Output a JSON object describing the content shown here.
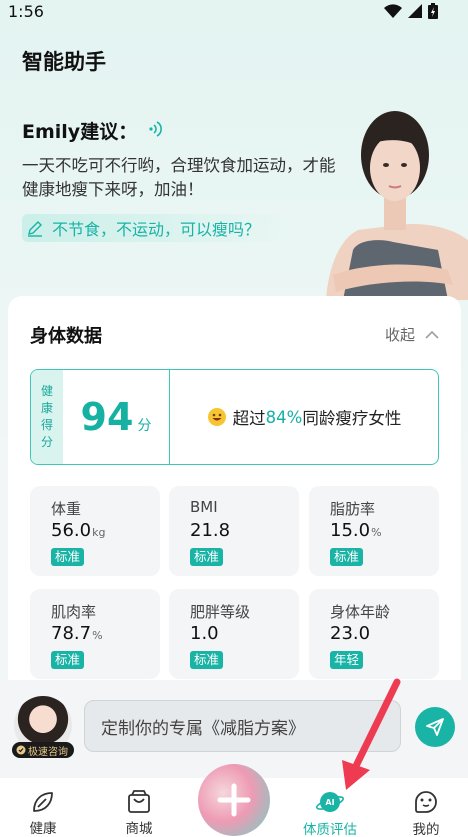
{
  "status": {
    "time": "1:56"
  },
  "header": {
    "title": "智能助手"
  },
  "advice": {
    "name": "Emily建议：",
    "text": "一天不吃可不行哟，合理饮食加运动，才能健康地瘦下来呀，加油！",
    "question": "不节食，不运动，可以瘦吗？"
  },
  "body_data": {
    "title": "身体数据",
    "collapse_label": "收起",
    "score": {
      "tag_chars": [
        "健",
        "康",
        "得",
        "分"
      ],
      "value": "94",
      "unit": "分",
      "compare_prefix": "超过",
      "compare_pct": "84%",
      "compare_suffix": "同龄瘦疗女性"
    },
    "metrics": [
      {
        "label": "体重",
        "value": "56.0",
        "unit": "kg",
        "badge": "标准"
      },
      {
        "label": "BMI",
        "value": "21.8",
        "unit": "",
        "badge": "标准"
      },
      {
        "label": "脂肪率",
        "value": "15.0",
        "unit": "%",
        "badge": "标准"
      },
      {
        "label": "肌肉率",
        "value": "78.7",
        "unit": "%",
        "badge": "标准"
      },
      {
        "label": "肥胖等级",
        "value": "1.0",
        "unit": "",
        "badge": "标准"
      },
      {
        "label": "身体年龄",
        "value": "23.0",
        "unit": "",
        "badge": "年轻"
      }
    ]
  },
  "input_bar": {
    "consult_label": "极速咨询",
    "placeholder": "定制你的专属《减脂方案》"
  },
  "tabs": [
    {
      "label": "健康",
      "icon": "leaf-icon"
    },
    {
      "label": "商城",
      "icon": "shopping-bag-icon"
    },
    {
      "label": "体质评估",
      "icon": "ai-planet-icon",
      "active": true
    },
    {
      "label": "我的",
      "icon": "face-icon"
    }
  ],
  "colors": {
    "accent": "#19b4a6",
    "background": "#f3f5f6"
  }
}
